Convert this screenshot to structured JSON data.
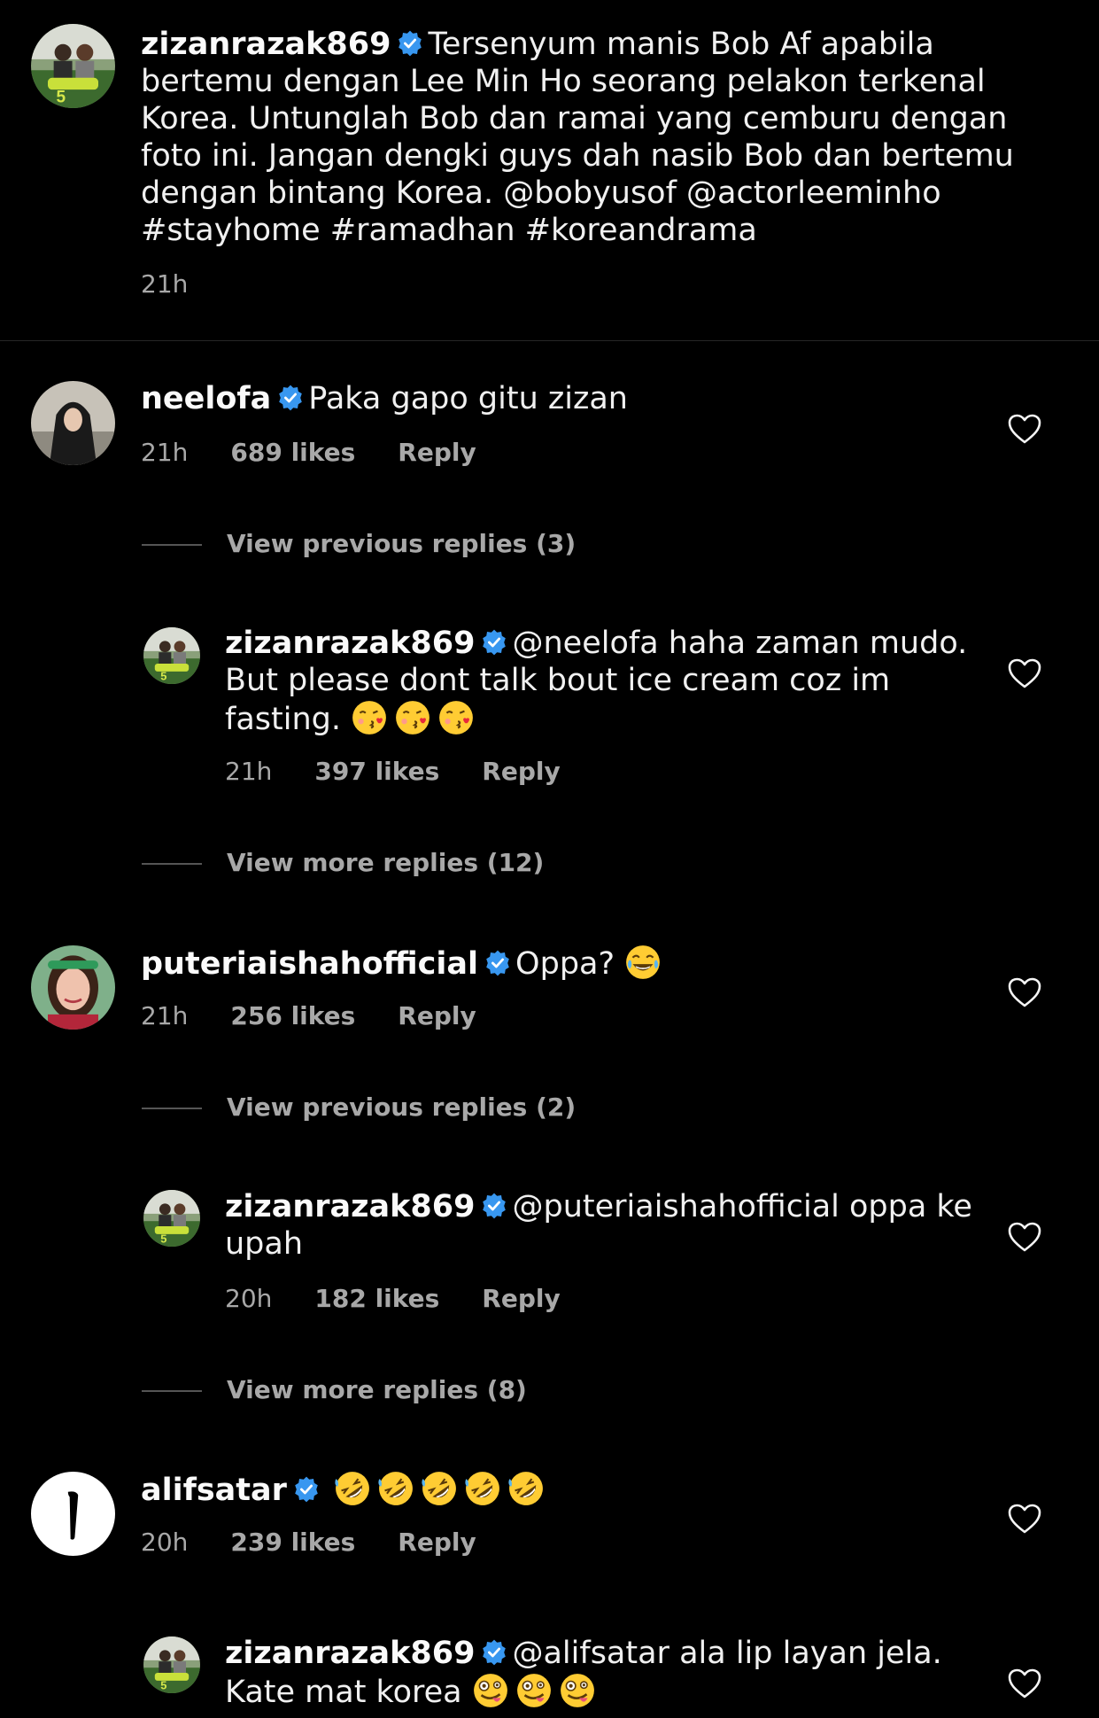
{
  "caption": {
    "username": "zizanrazak869",
    "text": "Tersenyum manis Bob Af apabila bertemu dengan Lee Min Ho seorang pelakon terkenal Korea. Untunglah Bob dan ramai yang cemburu dengan foto ini. Jangan dengki guys dah nasib Bob dan bertemu dengan bintang Korea. @bobyusof @actorleeminho #stayhome #ramadhan #koreandrama",
    "time": "21h"
  },
  "comments": [
    {
      "username": "neelofa",
      "text": "Paka gapo gitu zizan",
      "time": "21h",
      "likes": "689 likes",
      "reply": "Reply",
      "view_previous": "View previous replies (3)",
      "reply_item": {
        "username": "zizanrazak869",
        "text": "@neelofa haha zaman mudo. But please dont talk bout ice cream coz im fasting.",
        "emojis": [
          "kissing-face-emoji",
          "kissing-face-emoji",
          "kissing-face-emoji"
        ],
        "time": "21h",
        "likes": "397 likes",
        "reply": "Reply"
      },
      "view_more": "View more replies (12)"
    },
    {
      "username": "puteriaishahofficial",
      "text": "Oppa?",
      "emojis": [
        "tears-of-joy-emoji"
      ],
      "time": "21h",
      "likes": "256 likes",
      "reply": "Reply",
      "view_previous": "View previous replies (2)",
      "reply_item": {
        "username": "zizanrazak869",
        "text": "@puteriaishahofficial oppa ke upah",
        "time": "20h",
        "likes": "182 likes",
        "reply": "Reply"
      },
      "view_more": "View more replies (8)"
    },
    {
      "username": "alifsatar",
      "emojis": [
        "rolling-laughing-emoji",
        "rolling-laughing-emoji",
        "rolling-laughing-emoji",
        "rolling-laughing-emoji",
        "rolling-laughing-emoji"
      ],
      "time": "20h",
      "likes": "239 likes",
      "reply": "Reply",
      "reply_item": {
        "username": "zizanrazak869",
        "text": "@alifsatar ala lip layan jela. Kate mat korea",
        "emojis": [
          "zany-face-emoji",
          "zany-face-emoji",
          "zany-face-emoji"
        ]
      }
    }
  ],
  "colors": {
    "background": "#000000",
    "text": "#f5f5f5",
    "secondary": "#a8a8a8",
    "verified": "#3897f0"
  }
}
